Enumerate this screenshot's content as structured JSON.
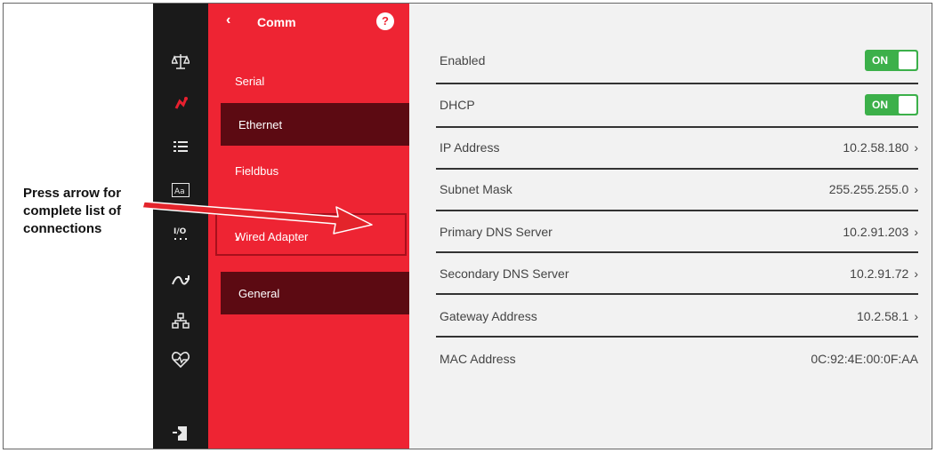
{
  "annotation": {
    "lines": [
      "Press arrow for",
      "complete list of",
      "connections"
    ],
    "arrow_color": "#e3242b"
  },
  "rail": {
    "icons": [
      {
        "name": "scale-icon",
        "glyph": "⚖"
      },
      {
        "name": "comm-icon",
        "glyph": "✦"
      },
      {
        "name": "list-icon",
        "glyph": "☰"
      },
      {
        "name": "text-format-icon",
        "glyph": "Aa"
      },
      {
        "name": "io-icon",
        "glyph": "I/O"
      },
      {
        "name": "flow-icon",
        "glyph": "⇄"
      },
      {
        "name": "network-icon",
        "glyph": "⊞"
      },
      {
        "name": "diagnostics-icon",
        "glyph": "♡"
      },
      {
        "name": "export-icon",
        "glyph": "⬇"
      }
    ]
  },
  "nav": {
    "back": "‹",
    "title": "Comm",
    "help": "?",
    "items": [
      {
        "label": "Serial"
      },
      {
        "label": "Ethernet"
      },
      {
        "label": "Fieldbus"
      },
      {
        "label": "Wired Adapter",
        "chevron": "›"
      },
      {
        "label": "General"
      }
    ],
    "accent": "#ee2433"
  },
  "settings": {
    "enabled": {
      "label": "Enabled",
      "toggle": "ON"
    },
    "dhcp": {
      "label": "DHCP",
      "toggle": "ON"
    },
    "ip": {
      "label": "IP Address",
      "value": "10.2.58.180",
      "chevron": "›"
    },
    "subnet": {
      "label": "Subnet Mask",
      "value": "255.255.255.0",
      "chevron": "›"
    },
    "dns1": {
      "label": "Primary DNS Server",
      "value": "10.2.91.203",
      "chevron": "›"
    },
    "dns2": {
      "label": "Secondary DNS Server",
      "value": "10.2.91.72",
      "chevron": "›"
    },
    "gateway": {
      "label": "Gateway Address",
      "value": "10.2.58.1",
      "chevron": "›"
    },
    "mac": {
      "label": "MAC Address",
      "value": "0C:92:4E:00:0F:AA"
    },
    "toggle_color": "#3cb04a"
  }
}
